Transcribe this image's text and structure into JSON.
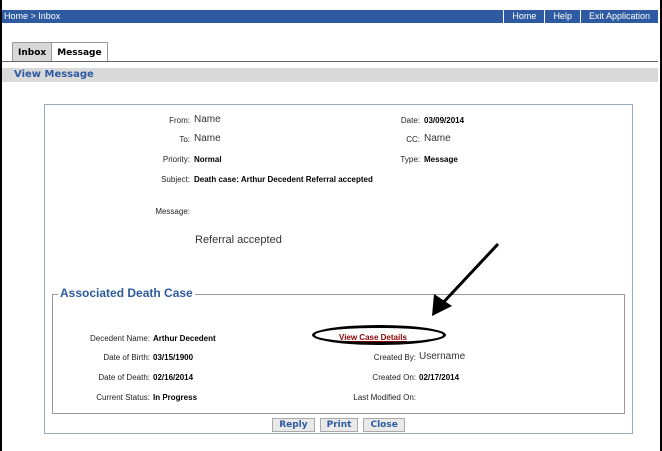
{
  "topbar": {
    "breadcrumb": "Home > Inbox",
    "nav": [
      "Home",
      "Help",
      "Exit Application"
    ]
  },
  "tabs": [
    "Inbox",
    "Message"
  ],
  "section_title": "View Message",
  "message": {
    "from_label": "From:",
    "from_value": "Name",
    "to_label": "To:",
    "to_value": "Name",
    "priority_label": "Priority:",
    "priority_value": "Normal",
    "subject_label": "Subject:",
    "subject_value": "Death case: Arthur Decedent Referral accepted",
    "date_label": "Date:",
    "date_value": "03/09/2014",
    "cc_label": "CC:",
    "cc_value": "Name",
    "type_label": "Type:",
    "type_value": "Message",
    "message_label": "Message:",
    "body": "Referral accepted"
  },
  "case": {
    "title": "Associated Death Case",
    "decedent_label": "Decedent Name:",
    "decedent_value": "Arthur Decedent",
    "dob_label": "Date of Birth:",
    "dob_value": "03/15/1900",
    "dod_label": "Date of Death:",
    "dod_value": "02/16/2014",
    "status_label": "Current Status:",
    "status_value": "In Progress",
    "view_link": "View Case Details",
    "created_by_label": "Created By:",
    "created_by_value": "Username",
    "created_on_label": "Created On:",
    "created_on_value": "02/17/2014",
    "modified_label": "Last Modified On:",
    "modified_value": ""
  },
  "buttons": {
    "reply": "Reply",
    "print": "Print",
    "close": "Close"
  }
}
